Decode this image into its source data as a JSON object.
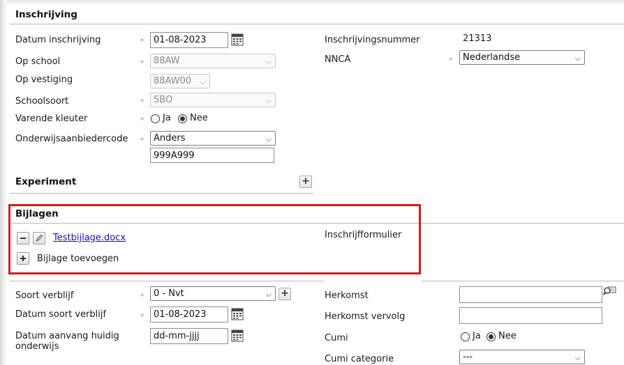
{
  "inschrijving": {
    "title": "Inschrijving",
    "datum_inschrijving": {
      "label": "Datum inschrijving",
      "value": "01-08-2023"
    },
    "op_school": {
      "label": "Op school",
      "value": "88AW"
    },
    "op_vestiging": {
      "label": "Op vestiging",
      "value": "88AW00"
    },
    "schoolsoort": {
      "label": "Schoolsoort",
      "value": "SBO"
    },
    "varende_kleuter": {
      "label": "Varende kleuter",
      "options": [
        "Ja",
        "Nee"
      ],
      "selected": "Nee"
    },
    "onderwijsaanbiedercode": {
      "label": "Onderwijsaanbiedercode",
      "value": "Anders",
      "code": "999A999"
    },
    "inschrijvingsnummer": {
      "label": "Inschrijvingsnummer",
      "value": "21313"
    },
    "nnca": {
      "label": "NNCA",
      "value": "Nederlandse"
    },
    "required_mark": "*"
  },
  "experiment": {
    "title": "Experiment",
    "add_symbol": "+"
  },
  "bijlagen": {
    "title": "Bijlagen",
    "file_link": "Testbijlage.docx",
    "file_type": "Inschrijfformulier",
    "add_label": "Bijlage toevoegen",
    "highlight_color": "#e0161b"
  },
  "verblijf": {
    "soort_verblijf": {
      "label": "Soort verblijf",
      "value": "0 - Nvt"
    },
    "datum_soort_verblijf": {
      "label": "Datum soort verblijf",
      "value": "01-08-2023"
    },
    "datum_aanvang": {
      "label_line1": "Datum aanvang huidig",
      "label_line2": "onderwijs",
      "value": "dd-mm-jjjj"
    },
    "herkomst": {
      "label": "Herkomst",
      "value": ""
    },
    "herkomst_vervolg": {
      "label": "Herkomst vervolg",
      "value": ""
    },
    "cumi": {
      "label": "Cumi",
      "options": [
        "Ja",
        "Nee"
      ],
      "selected": "Nee"
    },
    "cumi_categorie": {
      "label": "Cumi categorie",
      "value": "---"
    }
  }
}
